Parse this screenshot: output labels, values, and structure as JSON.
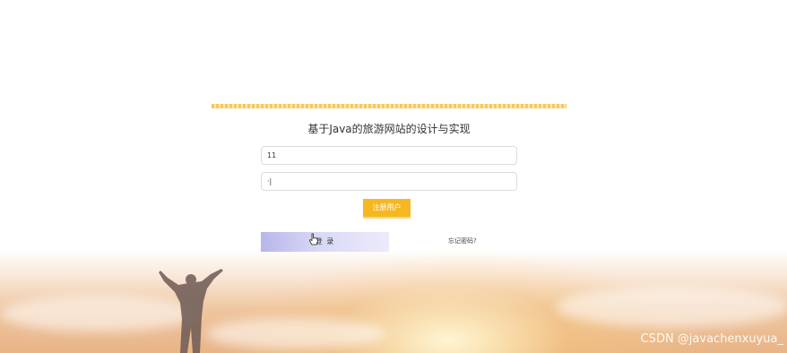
{
  "login_panel": {
    "title": "基于Java的旅游网站的设计与实现",
    "username_value": "11",
    "password_value": "·|",
    "register_label": "注册用户",
    "login_label": "登 录",
    "forgot_label": "忘记密码?"
  },
  "watermark": "CSDN @javachenxuyua_",
  "colors": {
    "register_button": "#f5b820",
    "login_button_start": "#b8b6ea",
    "stripe": "#f7c85a"
  },
  "icons": {
    "cursor": "hand-pointer-icon"
  }
}
